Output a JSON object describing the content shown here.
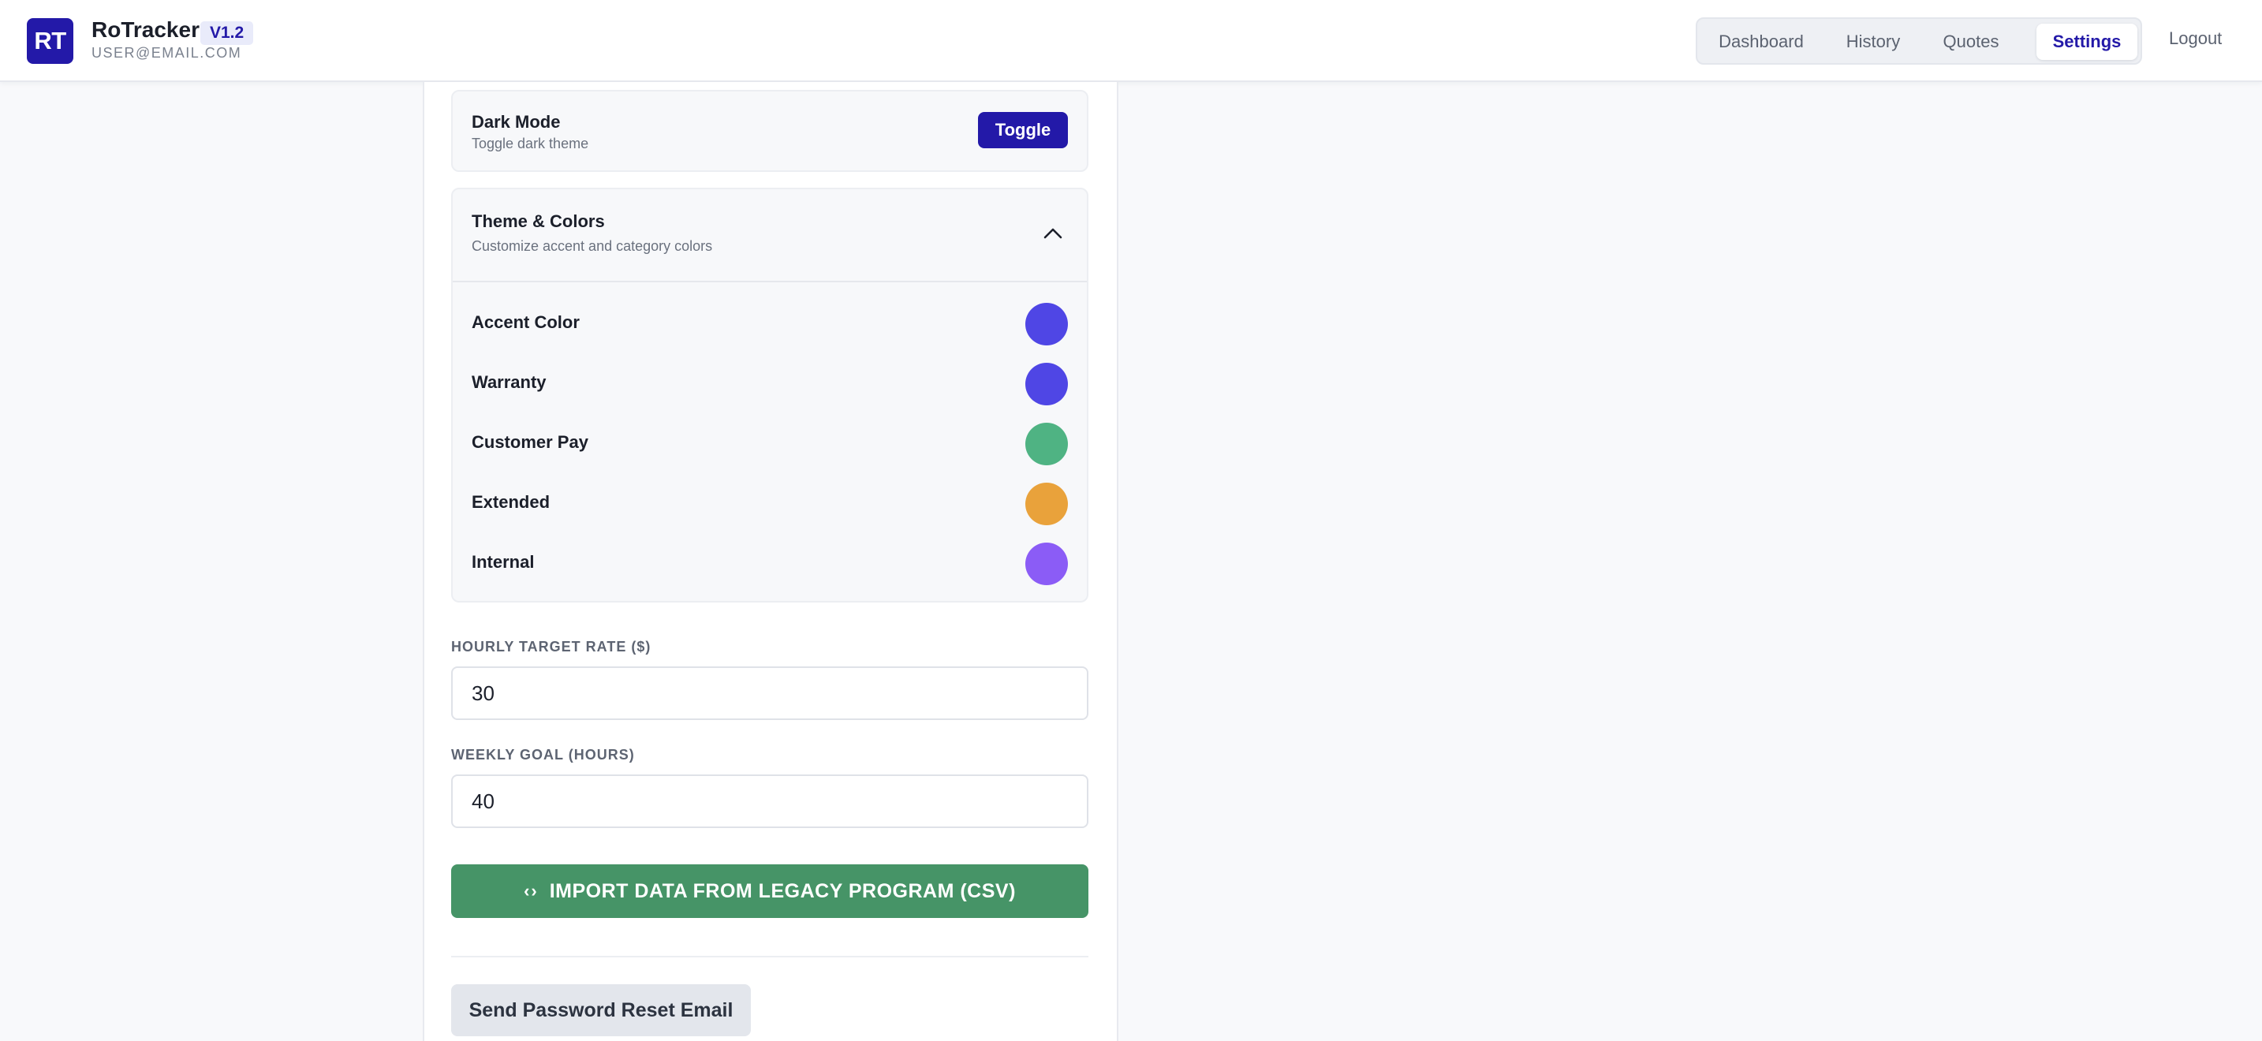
{
  "header": {
    "logo_initials": "RT",
    "app_name": "RoTracker",
    "version": "V1.2",
    "user_email": "USER@EMAIL.COM",
    "nav": [
      {
        "label": "Dashboard",
        "active": false
      },
      {
        "label": "History",
        "active": false
      },
      {
        "label": "Quotes",
        "active": false
      },
      {
        "label": "Settings",
        "active": true
      }
    ],
    "logout_label": "Logout"
  },
  "dark_mode": {
    "title": "Dark Mode",
    "subtitle": "Toggle dark theme",
    "button_label": "Toggle"
  },
  "theme": {
    "title": "Theme & Colors",
    "subtitle": "Customize accent and category colors",
    "expanded": true,
    "icon": "chevron-up-icon",
    "colors": [
      {
        "label": "Accent Color",
        "color": "#4f46e5"
      },
      {
        "label": "Warranty",
        "color": "#4f46e5"
      },
      {
        "label": "Customer Pay",
        "color": "#4fb383"
      },
      {
        "label": "Extended",
        "color": "#e9a23b"
      },
      {
        "label": "Internal",
        "color": "#8b5cf6"
      }
    ]
  },
  "hourly_rate": {
    "label": "HOURLY TARGET RATE ($)",
    "value": "30"
  },
  "weekly_goal": {
    "label": "WEEKLY GOAL (HOURS)",
    "value": "40"
  },
  "import": {
    "icon": "code-arrows-icon",
    "icon_glyph": "‹›",
    "label": "IMPORT DATA FROM LEGACY PROGRAM (CSV)"
  },
  "reset_password_label": "Send Password Reset Email",
  "colors": {
    "brand": "#2319a8",
    "import_green": "#469467"
  }
}
